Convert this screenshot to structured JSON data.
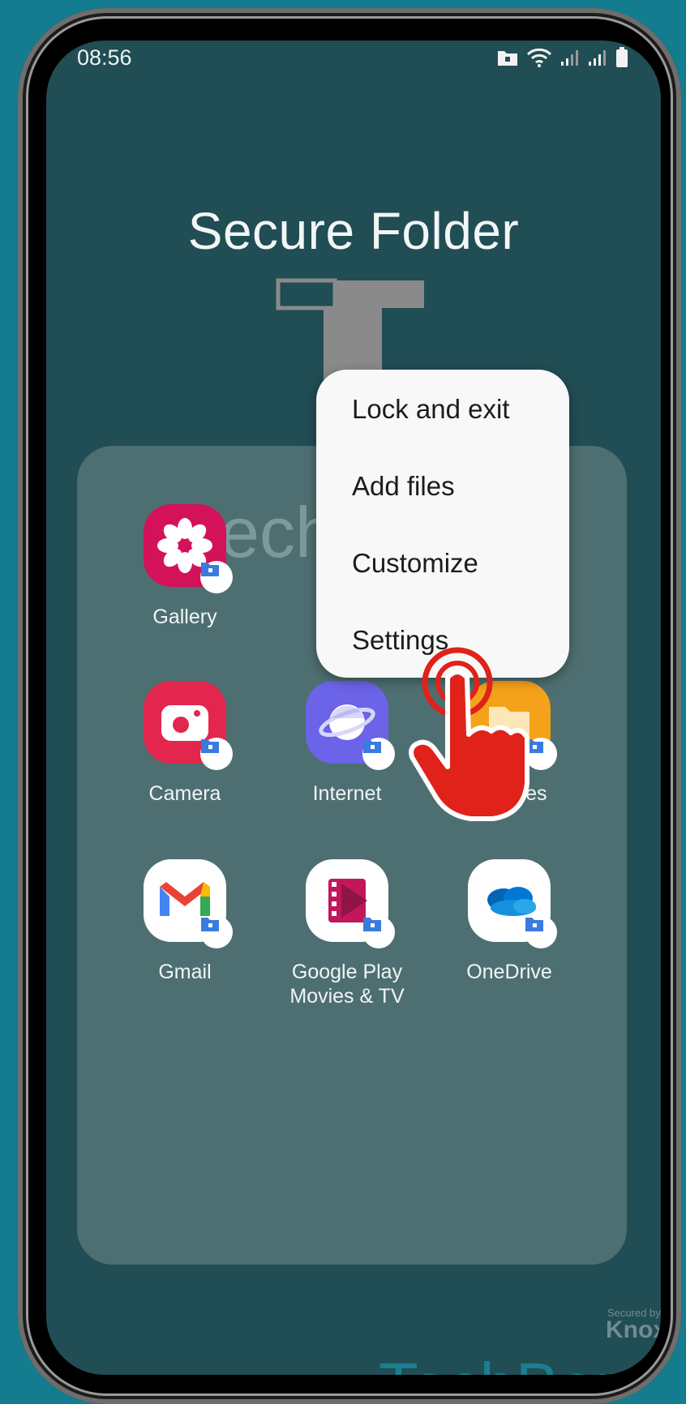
{
  "status_bar": {
    "time": "08:56"
  },
  "title": "Secure Folder",
  "apps": [
    {
      "label": "Gallery",
      "icon": "gallery-icon"
    },
    {
      "label": "Camera",
      "icon": "camera-icon"
    },
    {
      "label": "Internet",
      "icon": "internet-icon"
    },
    {
      "label": "My Files",
      "icon": "my-files-icon"
    },
    {
      "label": "Gmail",
      "icon": "gmail-icon"
    },
    {
      "label": "Google Play\nMovies & TV",
      "icon": "play-movies-icon"
    },
    {
      "label": "OneDrive",
      "icon": "onedrive-icon"
    }
  ],
  "menu": {
    "items": [
      "Lock and exit",
      "Add files",
      "Customize",
      "Settings"
    ]
  },
  "watermark": {
    "partial_text": "ech",
    "brand": "TechBone"
  },
  "knox": {
    "secured_by": "Secured by",
    "name": "Knox"
  },
  "colors": {
    "background": "#137C8E",
    "screen": "#214D54",
    "panel": "#4E6F71",
    "menu": "#F8F8F8"
  }
}
